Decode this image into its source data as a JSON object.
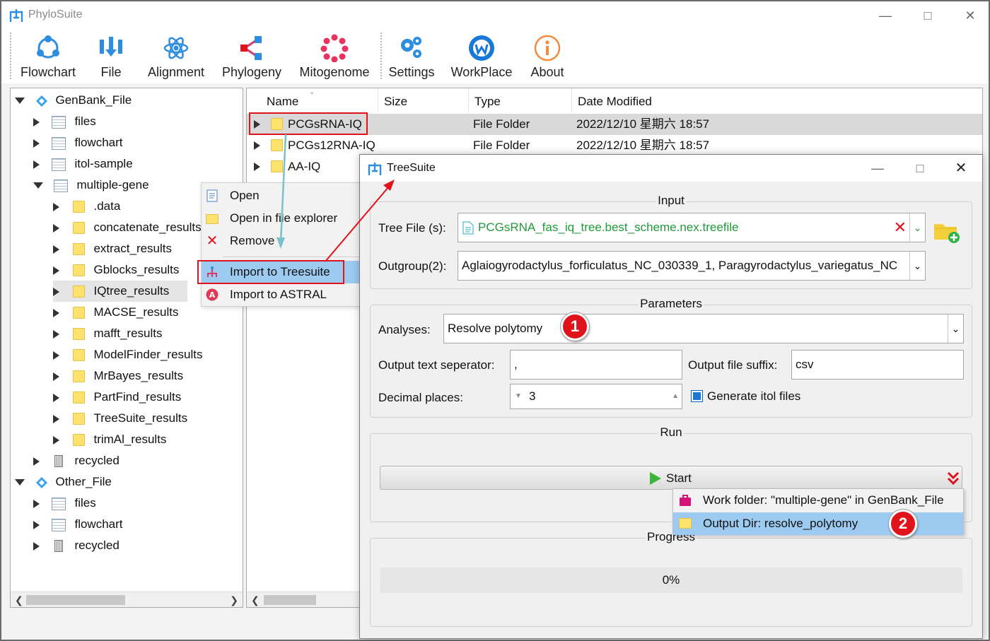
{
  "app": {
    "title": "PhyloSuite",
    "window_controls": [
      "minimize-icon",
      "maximize-icon",
      "close-icon"
    ],
    "accent_color": "#1a78d6"
  },
  "toolbar": {
    "items": [
      {
        "label": "Flowchart",
        "icon": "flowchart-icon"
      },
      {
        "label": "File",
        "icon": "file-icon"
      },
      {
        "label": "Alignment",
        "icon": "alignment-icon"
      },
      {
        "label": "Phylogeny",
        "icon": "phylogeny-icon"
      },
      {
        "label": "Mitogenome",
        "icon": "mitogenome-icon"
      },
      {
        "label": "Settings",
        "icon": "settings-icon"
      },
      {
        "label": "WorkPlace",
        "icon": "workplace-icon"
      },
      {
        "label": "About",
        "icon": "about-icon"
      }
    ]
  },
  "tree": {
    "items": [
      {
        "label": "GenBank_File",
        "icon": "workspace-icon",
        "expanded": true
      },
      {
        "label": "files",
        "icon": "table-icon"
      },
      {
        "label": "flowchart",
        "icon": "table-icon"
      },
      {
        "label": "itol-sample",
        "icon": "table-icon"
      },
      {
        "label": "multiple-gene",
        "icon": "table-icon",
        "expanded": true
      },
      {
        "label": ".data",
        "icon": "folder-icon"
      },
      {
        "label": "concatenate_results",
        "icon": "folder-icon"
      },
      {
        "label": "extract_results",
        "icon": "folder-icon"
      },
      {
        "label": "Gblocks_results",
        "icon": "folder-icon"
      },
      {
        "label": "IQtree_results",
        "icon": "folder-icon",
        "selected": true
      },
      {
        "label": "MACSE_results",
        "icon": "folder-icon"
      },
      {
        "label": "mafft_results",
        "icon": "folder-icon"
      },
      {
        "label": "ModelFinder_results",
        "icon": "folder-icon"
      },
      {
        "label": "MrBayes_results",
        "icon": "folder-icon"
      },
      {
        "label": "PartFind_results",
        "icon": "folder-icon"
      },
      {
        "label": "TreeSuite_results",
        "icon": "folder-icon"
      },
      {
        "label": "trimAl_results",
        "icon": "folder-icon"
      },
      {
        "label": "recycled",
        "icon": "recycle-bin-icon"
      },
      {
        "label": "Other_File",
        "icon": "workspace-icon",
        "expanded": true
      },
      {
        "label": "files",
        "icon": "table-icon"
      },
      {
        "label": "flowchart",
        "icon": "table-icon"
      },
      {
        "label": "recycled",
        "icon": "recycle-bin-icon"
      }
    ]
  },
  "file_table": {
    "columns": [
      "Name",
      "Size",
      "Type",
      "Date Modified"
    ],
    "rows": [
      {
        "name": "PCGsRNA-IQ",
        "size": "",
        "type": "File Folder",
        "date": "2022/12/10 星期六 18:57"
      },
      {
        "name": "PCGs12RNA-IQ",
        "size": "",
        "type": "File Folder",
        "date": "2022/12/10 星期六 18:57"
      },
      {
        "name": "AA-IQ",
        "size": "",
        "type": "",
        "date": ""
      }
    ]
  },
  "context_menu": {
    "items": [
      {
        "label": "Open",
        "icon": "open-icon"
      },
      {
        "label": "Open in file explorer",
        "icon": "folder-icon"
      },
      {
        "label": "Remove",
        "icon": "remove-icon"
      },
      {
        "label": "Import to Treesuite",
        "icon": "treesuite-icon",
        "highlighted": true
      },
      {
        "label": "Import to ASTRAL",
        "icon": "astral-icon"
      }
    ]
  },
  "dialog": {
    "title": "TreeSuite",
    "input_group": "Input",
    "tree_file_label": "Tree File (s):",
    "tree_file_value": "PCGsRNA_fas_iq_tree.best_scheme.nex.treefile",
    "outgroup_label": "Outgroup(2):",
    "outgroup_value": "Aglaiogyrodactylus_forficulatus_NC_030339_1, Paragyrodactylus_variegatus_NC",
    "parameters_group": "Parameters",
    "analyses_label": "Analyses:",
    "analyses_value": "Resolve polytomy",
    "separator_label": "Output text seperator:",
    "separator_value": ",",
    "suffix_label": "Output file suffix:",
    "suffix_value": "csv",
    "decimal_label": "Decimal places:",
    "decimal_value": "3",
    "itol_label": "Generate itol files",
    "itol_checked": true,
    "run_group": "Run",
    "start_label": "Start",
    "run_menu": [
      {
        "label": "Work folder: \"multiple-gene\" in GenBank_File",
        "icon": "work-folder-icon"
      },
      {
        "label": "Output Dir: resolve_polytomy",
        "icon": "folder-icon",
        "highlighted": true
      }
    ],
    "progress_group": "Progress",
    "progress_text": "0%",
    "progress_value": 0
  },
  "annotations": {
    "badge1": "1",
    "badge2": "2",
    "color": "#e0121a"
  }
}
